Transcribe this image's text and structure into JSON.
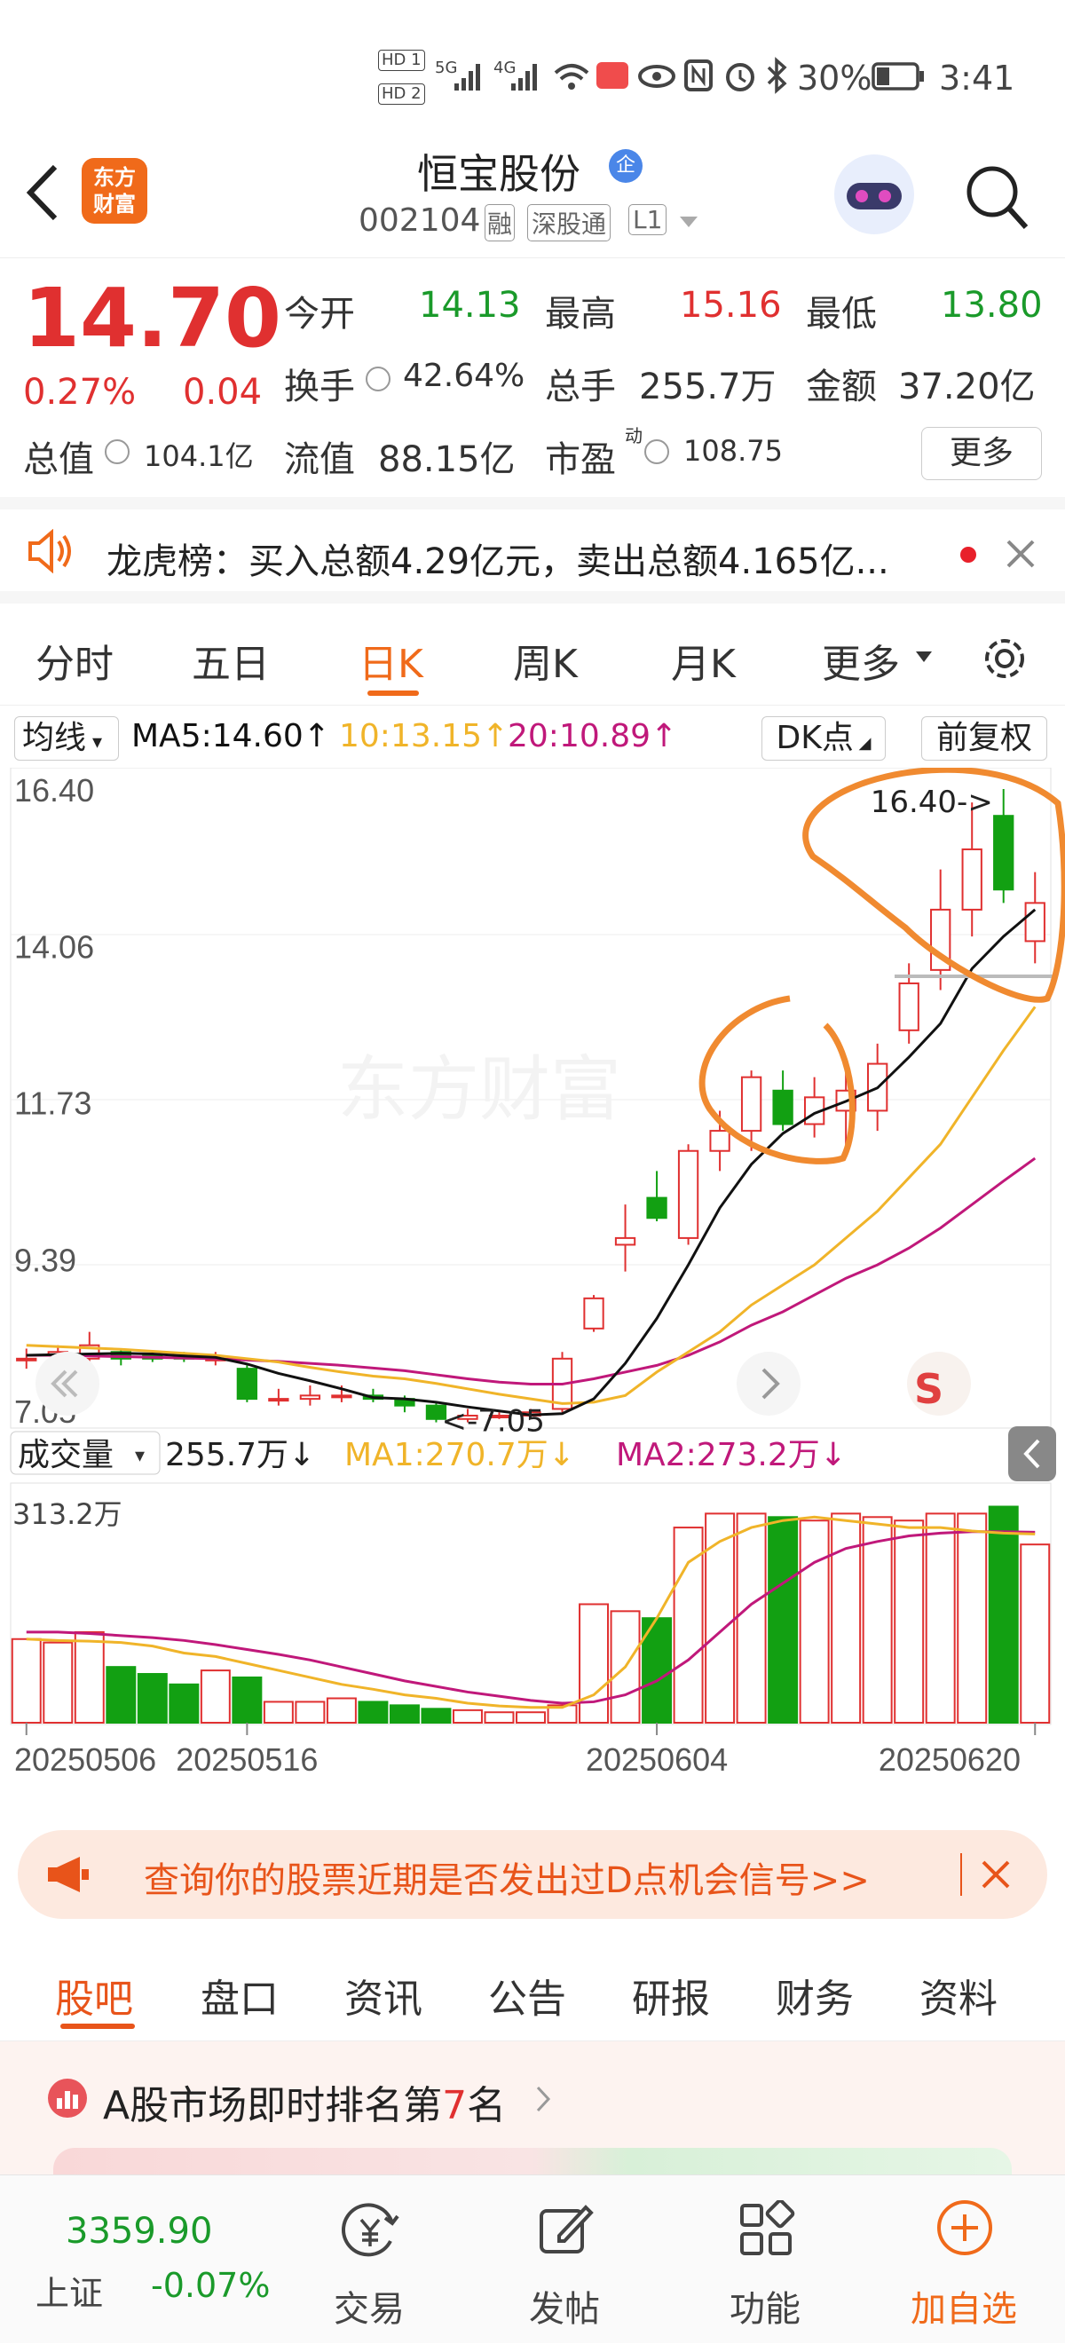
{
  "status_bar": {
    "hd1": "HD 1",
    "hd2": "HD 2",
    "net1": "5G",
    "net2": "4G",
    "battery": "30%",
    "time": "3:41"
  },
  "header": {
    "logo_line1": "东方",
    "logo_line2": "财富",
    "stock_name": "恒宝股份",
    "badge": "企",
    "code": "002104",
    "tag1": "融",
    "tag2": "深股通",
    "tag3": "L1"
  },
  "quote": {
    "price": "14.70",
    "change_pct": "0.27%",
    "change": "0.04",
    "open_label": "今开",
    "open": "14.13",
    "high_label": "最高",
    "high": "15.16",
    "low_label": "最低",
    "low": "13.80",
    "turnover_label": "换手",
    "turnover": "42.64%",
    "volume_label": "总手",
    "volume": "255.7万",
    "amount_label": "金额",
    "amount": "37.20亿",
    "mktcap_label": "总值",
    "mktcap": "104.1亿",
    "float_label": "流值",
    "float": "88.15亿",
    "pe_label": "市盈",
    "pe_sup": "动",
    "pe": "108.75",
    "more": "更多"
  },
  "dragon": {
    "text": "龙虎榜：买入总额4.29亿元，卖出总额4.165亿..."
  },
  "tabs": [
    "分时",
    "五日",
    "日K",
    "周K",
    "月K",
    "更多"
  ],
  "active_tab": 2,
  "kline": {
    "ma_select": "均线",
    "ma5": "MA5:14.60↑",
    "ma10": "10:13.15↑",
    "ma20": "20:10.89↑",
    "dk": "DK点",
    "fq": "前复权",
    "y_ticks": [
      "16.40",
      "14.06",
      "11.73",
      "9.39",
      "7.05"
    ],
    "max_label": "16.40->",
    "min_label": "<-7.05",
    "watermark": "东方财富"
  },
  "volume": {
    "select": "成交量",
    "value": "255.7万↓",
    "ma1": "MA1:270.7万↓",
    "ma2": "MA2:273.2万↓",
    "max_label": "313.2万"
  },
  "x_dates": [
    "20250506",
    "20250516",
    "20250604",
    "20250620"
  ],
  "chart_data": {
    "type": "candlestick",
    "ylim": [
      7.05,
      16.4
    ],
    "candles": [
      [
        7.9,
        7.9,
        8.05,
        7.75
      ],
      [
        7.95,
        8.0,
        8.1,
        7.85
      ],
      [
        7.9,
        8.1,
        8.3,
        7.85
      ],
      [
        8.0,
        7.9,
        8.05,
        7.8
      ],
      [
        7.95,
        7.9,
        8.0,
        7.85
      ],
      [
        7.95,
        7.9,
        8.0,
        7.85
      ],
      [
        7.9,
        7.9,
        8.0,
        7.8
      ],
      [
        7.75,
        7.3,
        7.8,
        7.25
      ],
      [
        7.3,
        7.3,
        7.45,
        7.2
      ],
      [
        7.3,
        7.35,
        7.5,
        7.2
      ],
      [
        7.35,
        7.35,
        7.5,
        7.25
      ],
      [
        7.35,
        7.3,
        7.45,
        7.25
      ],
      [
        7.3,
        7.2,
        7.35,
        7.1
      ],
      [
        7.2,
        7.0,
        7.25,
        6.95
      ],
      [
        7.0,
        7.05,
        7.15,
        6.95
      ],
      [
        7.05,
        7.05,
        7.1,
        7.0
      ],
      [
        7.05,
        7.1,
        7.15,
        7.0
      ],
      [
        7.15,
        7.9,
        8.0,
        7.1
      ],
      [
        8.35,
        8.8,
        8.85,
        8.3
      ],
      [
        9.6,
        9.7,
        10.2,
        9.2
      ],
      [
        10.3,
        10.0,
        10.7,
        9.95
      ],
      [
        9.7,
        11.0,
        11.1,
        9.6
      ],
      [
        11.0,
        11.3,
        11.6,
        10.7
      ],
      [
        11.3,
        12.1,
        12.2,
        11.0
      ],
      [
        11.9,
        11.4,
        12.2,
        11.3
      ],
      [
        11.4,
        11.8,
        12.1,
        11.2
      ],
      [
        11.6,
        11.9,
        12.3,
        11.0
      ],
      [
        11.6,
        12.3,
        12.6,
        11.3
      ],
      [
        12.8,
        13.5,
        13.8,
        12.6
      ],
      [
        13.7,
        14.6,
        15.2,
        13.4
      ],
      [
        14.6,
        15.5,
        16.2,
        14.2
      ],
      [
        16.0,
        14.9,
        16.4,
        14.7
      ],
      [
        14.13,
        14.7,
        15.16,
        13.8
      ]
    ],
    "ma5": [
      7.95,
      7.96,
      7.97,
      7.98,
      7.97,
      7.94,
      7.92,
      7.82,
      7.68,
      7.57,
      7.45,
      7.32,
      7.3,
      7.25,
      7.18,
      7.12,
      7.06,
      7.08,
      7.3,
      7.83,
      8.5,
      9.3,
      10.15,
      10.8,
      11.26,
      11.56,
      11.74,
      11.94,
      12.4,
      12.9,
      13.72,
      14.2,
      14.6
    ],
    "ma10": [
      8.1,
      8.08,
      8.06,
      8.04,
      8.01,
      7.98,
      7.95,
      7.9,
      7.85,
      7.77,
      7.7,
      7.64,
      7.6,
      7.53,
      7.45,
      7.37,
      7.3,
      7.23,
      7.25,
      7.35,
      7.7,
      8.0,
      8.3,
      8.7,
      9.0,
      9.3,
      9.7,
      10.1,
      10.6,
      11.1,
      11.8,
      12.5,
      13.15
    ],
    "ma20": [
      7.95,
      7.95,
      7.94,
      7.93,
      7.92,
      7.91,
      7.9,
      7.88,
      7.86,
      7.83,
      7.8,
      7.76,
      7.72,
      7.66,
      7.6,
      7.55,
      7.52,
      7.52,
      7.6,
      7.7,
      7.8,
      7.95,
      8.15,
      8.4,
      8.6,
      8.85,
      9.1,
      9.3,
      9.55,
      9.85,
      10.2,
      10.55,
      10.89
    ],
    "volumes": [
      120,
      115,
      130,
      80,
      70,
      55,
      75,
      65,
      30,
      30,
      35,
      30,
      25,
      20,
      18,
      15,
      15,
      25,
      170,
      160,
      150,
      280,
      300,
      300,
      295,
      290,
      300,
      295,
      290,
      300,
      300,
      310,
      255.7
    ],
    "vol_ylim": [
      0,
      313.2
    ],
    "vol_ma1": [
      120,
      118,
      117,
      115,
      110,
      100,
      95,
      85,
      75,
      65,
      55,
      48,
      40,
      35,
      28,
      24,
      22,
      22,
      40,
      80,
      150,
      230,
      260,
      280,
      290,
      295,
      290,
      285,
      280,
      280,
      275,
      272,
      270.7
    ],
    "vol_ma2": [
      130,
      130,
      128,
      125,
      122,
      118,
      112,
      105,
      98,
      90,
      80,
      70,
      60,
      52,
      44,
      38,
      32,
      28,
      30,
      40,
      60,
      90,
      130,
      170,
      200,
      230,
      250,
      260,
      268,
      272,
      274,
      274,
      273.2
    ]
  },
  "banner": {
    "text": "查询你的股票近期是否发出过D点机会信号>>"
  },
  "bottom_tabs": [
    "股吧",
    "盘口",
    "资讯",
    "公告",
    "研报",
    "财务",
    "资料"
  ],
  "rank": {
    "prefix": "A股市场即时排名第",
    "num": "7",
    "suffix": "名"
  },
  "nav": {
    "index_value": "3359.90",
    "index_name": "上证",
    "index_change": "-0.07%",
    "trade": "交易",
    "post": "发帖",
    "func": "功能",
    "add": "加自选"
  },
  "colors": {
    "up": "#e03030",
    "down": "#12a012",
    "brand": "#f06a1a",
    "ma5": "#111111",
    "ma10": "#f0b429",
    "ma20": "#c0187a",
    "annot": "#f08a30"
  }
}
